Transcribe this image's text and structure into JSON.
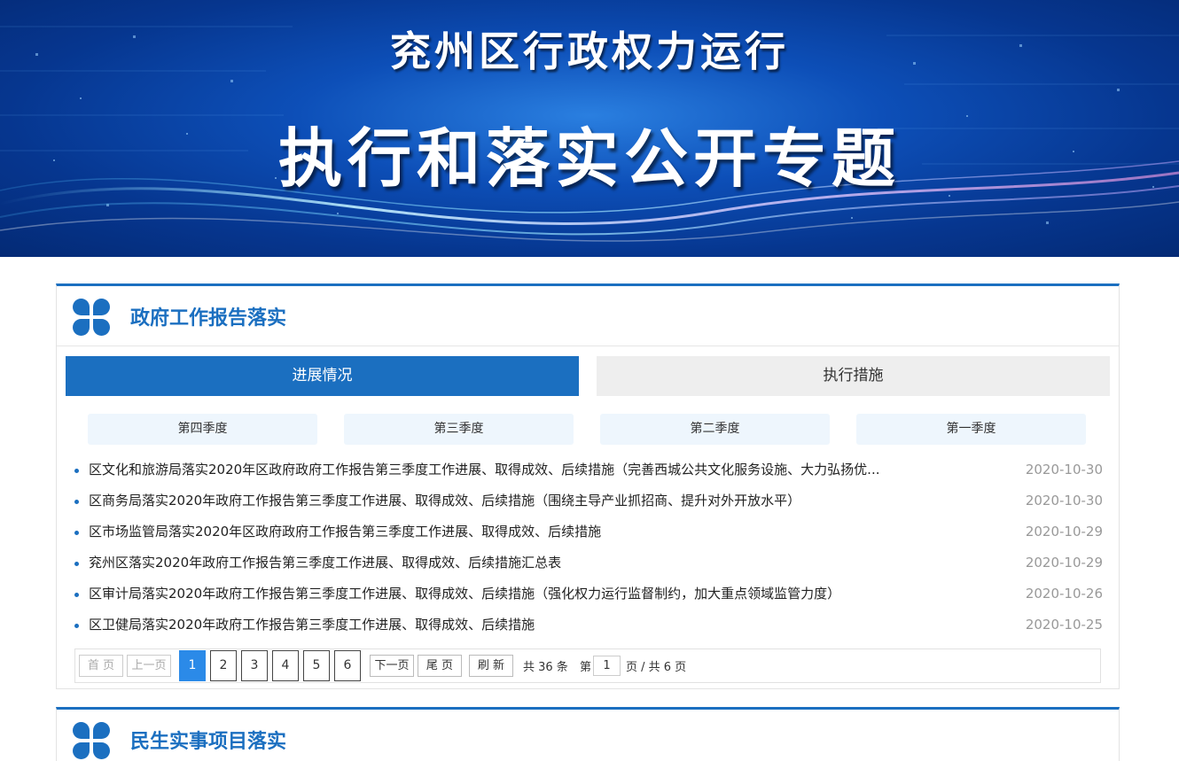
{
  "banner": {
    "line1": "兖州区行政权力运行",
    "line2": "执行和落实公开专题"
  },
  "colors": {
    "accent": "#1b6fc0",
    "page_active": "#2b8ae8"
  },
  "section1": {
    "title": "政府工作报告落实",
    "tabs": [
      {
        "label": "进展情况",
        "active": true
      },
      {
        "label": "执行措施",
        "active": false
      }
    ],
    "subtabs": [
      "第四季度",
      "第三季度",
      "第二季度",
      "第一季度"
    ],
    "items": [
      {
        "title": "区文化和旅游局落实2020年区政府政府工作报告第三季度工作进展、取得成效、后续措施（完善西城公共文化服务设施、大力弘扬优...",
        "date": "2020-10-30"
      },
      {
        "title": "区商务局落实2020年政府工作报告第三季度工作进展、取得成效、后续措施（围绕主导产业抓招商、提升对外开放水平）",
        "date": "2020-10-30"
      },
      {
        "title": "区市场监管局落实2020年区政府政府工作报告第三季度工作进展、取得成效、后续措施",
        "date": "2020-10-29"
      },
      {
        "title": "兖州区落实2020年政府工作报告第三季度工作进展、取得成效、后续措施汇总表",
        "date": "2020-10-29"
      },
      {
        "title": "区审计局落实2020年政府工作报告第三季度工作进展、取得成效、后续措施（强化权力运行监督制约，加大重点领域监管力度）",
        "date": "2020-10-26"
      },
      {
        "title": "区卫健局落实2020年政府工作报告第三季度工作进展、取得成效、后续措施",
        "date": "2020-10-25"
      }
    ],
    "pager": {
      "first": "首 页",
      "prev": "上一页",
      "pages": [
        "1",
        "2",
        "3",
        "4",
        "5",
        "6"
      ],
      "current_page": 1,
      "next": "下一页",
      "last": "尾 页",
      "refresh": "刷 新",
      "total": "共 36 条",
      "page_prefix": "第",
      "page_value": "1",
      "page_suffix": "页 / 共 6 页"
    }
  },
  "section2": {
    "title": "民生实事项目落实"
  }
}
